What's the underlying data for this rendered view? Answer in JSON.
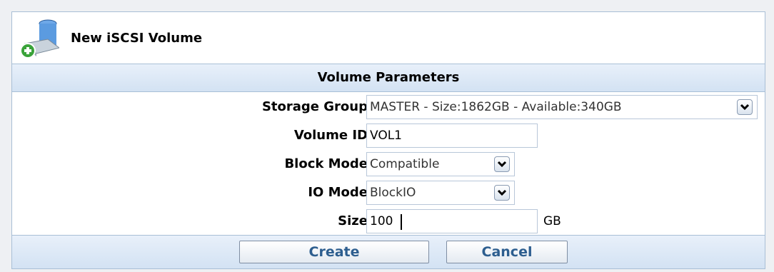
{
  "header": {
    "title": "New iSCSI Volume",
    "icon": "database-add-icon"
  },
  "section": {
    "title": "Volume Parameters"
  },
  "form": {
    "storage_group": {
      "label": "Storage Group",
      "value": "MASTER - Size:1862GB - Available:340GB"
    },
    "volume_id": {
      "label": "Volume ID",
      "value": "VOL1"
    },
    "block_mode": {
      "label": "Block Mode",
      "value": "Compatible"
    },
    "io_mode": {
      "label": "IO Mode",
      "value": "BlockIO"
    },
    "size": {
      "label": "Size",
      "value": "100",
      "unit": "GB"
    }
  },
  "buttons": {
    "create": "Create",
    "cancel": "Cancel"
  },
  "colors": {
    "border": "#a9bfd6",
    "section_bg": "#d3e2f3",
    "button_text": "#2d5e8f"
  }
}
